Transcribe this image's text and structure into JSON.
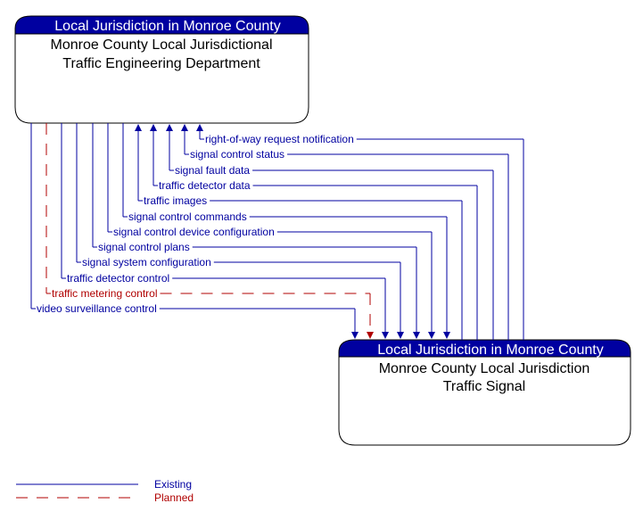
{
  "colors": {
    "existing": "#0000a0",
    "planned": "#b00000",
    "header_bg": "#0000a0",
    "box_border": "#000000"
  },
  "top_box": {
    "header": "Local Jurisdiction in Monroe County",
    "title_lines": [
      "Monroe County Local Jurisdictional",
      "Traffic Engineering Department"
    ]
  },
  "bottom_box": {
    "header": "Local Jurisdiction in Monroe County",
    "title_lines": [
      "Monroe County Local Jurisdiction",
      "Traffic Signal"
    ]
  },
  "flows": [
    {
      "label": "right-of-way request notification",
      "direction": "to-top",
      "status": "existing"
    },
    {
      "label": "signal control status",
      "direction": "to-top",
      "status": "existing"
    },
    {
      "label": "signal fault data",
      "direction": "to-top",
      "status": "existing"
    },
    {
      "label": "traffic detector data",
      "direction": "to-top",
      "status": "existing"
    },
    {
      "label": "traffic images",
      "direction": "to-top",
      "status": "existing"
    },
    {
      "label": "signal control commands",
      "direction": "to-bottom",
      "status": "existing"
    },
    {
      "label": "signal control device configuration",
      "direction": "to-bottom",
      "status": "existing"
    },
    {
      "label": "signal control plans",
      "direction": "to-bottom",
      "status": "existing"
    },
    {
      "label": "signal system configuration",
      "direction": "to-bottom",
      "status": "existing"
    },
    {
      "label": "traffic detector control",
      "direction": "to-bottom",
      "status": "existing"
    },
    {
      "label": "traffic metering control",
      "direction": "to-bottom",
      "status": "planned"
    },
    {
      "label": "video surveillance control",
      "direction": "to-bottom",
      "status": "existing"
    }
  ],
  "legend": [
    {
      "label": "Existing",
      "status": "existing"
    },
    {
      "label": "Planned",
      "status": "planned"
    }
  ]
}
